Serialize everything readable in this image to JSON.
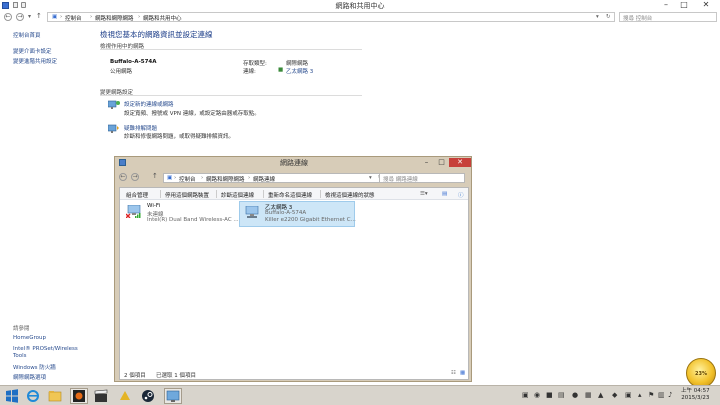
{
  "window": {
    "title": "網路和共用中心",
    "address_crumbs": [
      "控制台",
      "網路和網際網路",
      "網路和共用中心"
    ],
    "search_placeholder": "搜尋 控制台"
  },
  "sidebar": {
    "items": [
      {
        "label": "控制台首頁"
      },
      {
        "label": "變更介面卡設定"
      },
      {
        "label": "變更進階共用設定"
      }
    ],
    "see_also": {
      "heading": "請參閱",
      "items": [
        {
          "label": "HomeGroup"
        },
        {
          "label": "Intel® PROSet/Wireless Tools"
        },
        {
          "label": "Windows 防火牆"
        },
        {
          "label": "網際網路選項"
        }
      ]
    }
  },
  "main": {
    "heading": "檢視您基本的網路資訊並設定連線",
    "active_networks_label": "檢視作用中的網路",
    "network": {
      "name": "Buffalo-A-574A",
      "type": "公用網路",
      "access_type_label": "存取類型:",
      "access_type_value": "網際網路",
      "connections_label": "連線:",
      "connections_value": "乙太網路 3"
    },
    "change_settings_label": "變更網路設定",
    "tasks": [
      {
        "title": "設定新的連線或網路",
        "desc": "設定寬頻、撥號或 VPN 連線，或設定路由器或存取點。"
      },
      {
        "title": "疑難排解問題",
        "desc": "診斷和修復網路問題，或取得疑難排解資訊。"
      }
    ]
  },
  "subwindow": {
    "title": "網路連線",
    "address_crumbs": [
      "控制台",
      "網路和網際網路",
      "網路連線"
    ],
    "search_placeholder": "搜尋 網路連線",
    "toolbar": [
      "組合管理",
      "停用這個網路裝置",
      "診斷這個連線",
      "重新命名這個連線",
      "檢視這個連線的狀態"
    ],
    "adapters": [
      {
        "name": "Wi-Fi",
        "status": "未連線",
        "device": "Intel(R) Dual Band Wireless-AC ...",
        "selected": false
      },
      {
        "name": "乙太網路 3",
        "status": "Buffalo-A-574A",
        "device": "Killer e2200 Gigabit Ethernet C...",
        "selected": true
      }
    ],
    "status_items": "2 個項目",
    "status_selected": "已選取 1 個項目"
  },
  "orb_label": "23%",
  "taskbar": {
    "clock_time": "上午 04:57",
    "clock_date": "2015/3/23"
  }
}
